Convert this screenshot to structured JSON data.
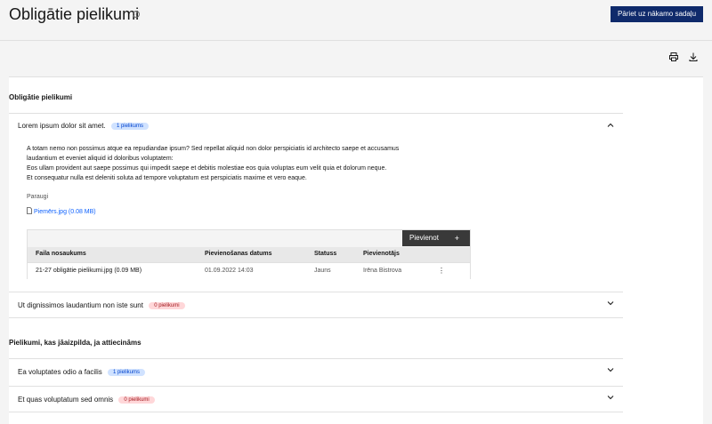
{
  "header": {
    "title": "Obligātie pielikumi",
    "help_symbol": "?",
    "primary_button": "Pāriet uz nākamo sadaļu"
  },
  "toolbar": {
    "print_icon": "printer-icon",
    "download_icon": "download-icon"
  },
  "sections": [
    {
      "title": "Obligātie pielikumi",
      "items": [
        {
          "label": "Lorem ipsum dolor sit amet.",
          "tag": "1 pielikums",
          "tag_color": "blue",
          "expanded": true,
          "description": [
            "A totam nemo non possimus atque ea repudiandae ipsum? Sed repellat aliquid non dolor perspiciatis id architecto saepe et accusamus",
            "laudantium et eveniet aliquid id doloribus voluptatem:",
            "Eos ullam provident aut saepe possimus qui impedit saepe et debitis molestiae eos quia voluptas eum velit quia et dolorum neque.",
            "Et consequatur nulla est deleniti soluta ad tempore voluptatum est perspiciatis maxime et vero eaque."
          ],
          "examples_label": "Paraugi",
          "example_file": "Piemērs.jpg (0.08 MB)",
          "table": {
            "add_button": "Pievienot",
            "add_symbol": "+",
            "columns": [
              "Faila nosaukums",
              "Pievienošanas datums",
              "Statuss",
              "Pievienotājs"
            ],
            "rows": [
              [
                "21-27 obligātie pielikumi.jpg (0.09 MB)",
                "01.09.2022 14:03",
                "Jauns",
                "Irēna Bistrova"
              ]
            ],
            "row_menu_symbol": "⋮"
          }
        },
        {
          "label": "Ut dignissimos laudantium non iste sunt",
          "tag": "0 pielikumi",
          "tag_color": "red",
          "expanded": false
        }
      ]
    },
    {
      "title": "Pielikumi, kas jāaizpilda, ja attiecināms",
      "items": [
        {
          "label": "Ea voluptates odio a facilis",
          "tag": "1 pielikums",
          "tag_color": "blue",
          "expanded": false
        },
        {
          "label": "Et quas voluptatum sed omnis",
          "tag": "0 pielikumi",
          "tag_color": "red",
          "expanded": false
        }
      ]
    }
  ],
  "colors": {
    "primary": "#0f2a6b",
    "link": "#0f62fe",
    "tag_blue_bg": "#d0e2ff",
    "tag_red_bg": "#ffd7d9"
  }
}
